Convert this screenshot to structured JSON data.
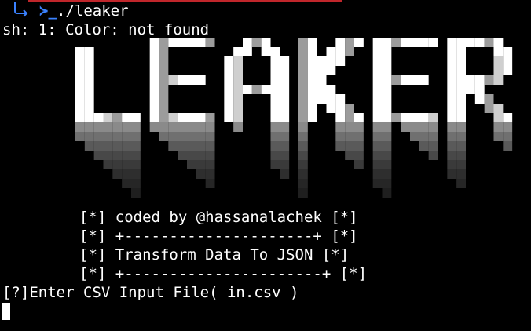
{
  "terminal": {
    "prompt_symbol": "≻_",
    "command": "./leaker",
    "error_line": "sh: 1: Color: not found",
    "banner_logo_text": "LEAKER",
    "info_lines": [
      "[*] coded by @hassanalachek [*]",
      "[*] +---------------------+ [*]",
      "[*] Transform Data To JSON [*]",
      "[*] +----------------------+ [*]"
    ],
    "input_prompt": "[?]Enter CSV Input File( in.csv )"
  },
  "colors": {
    "background": "#000000",
    "foreground": "#ffffff",
    "prompt_accent": "#3b82ff",
    "top_bar_accent": "#c0262b"
  }
}
